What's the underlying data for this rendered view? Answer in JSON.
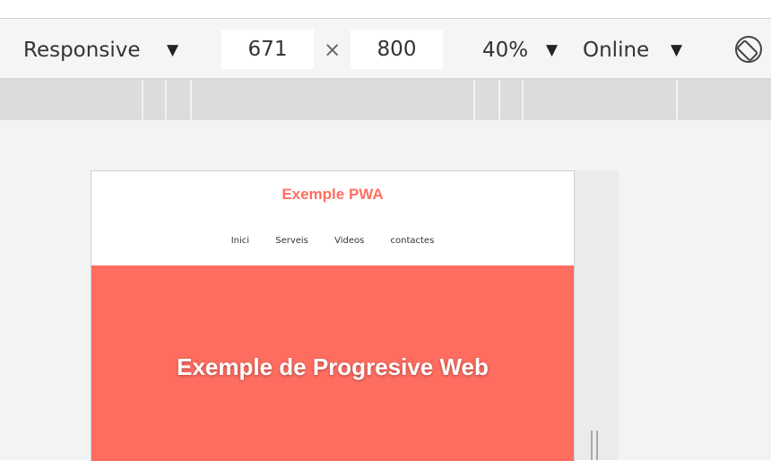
{
  "toolbar": {
    "device_label": "Responsive",
    "width_value": "671",
    "times_symbol": "×",
    "height_value": "800",
    "zoom_label": "40%",
    "throttle_label": "Online",
    "dropdown_arrow": "▼",
    "rotate_icon": "rotate-icon"
  },
  "page": {
    "site_title": "Exemple PWA",
    "nav": [
      "Inici",
      "Serveis",
      "Videos",
      "contactes"
    ],
    "hero_title": "Exemple de Progresive Web",
    "colors": {
      "accent": "#ff6f61",
      "hero_bg": "#ff6d61"
    }
  }
}
